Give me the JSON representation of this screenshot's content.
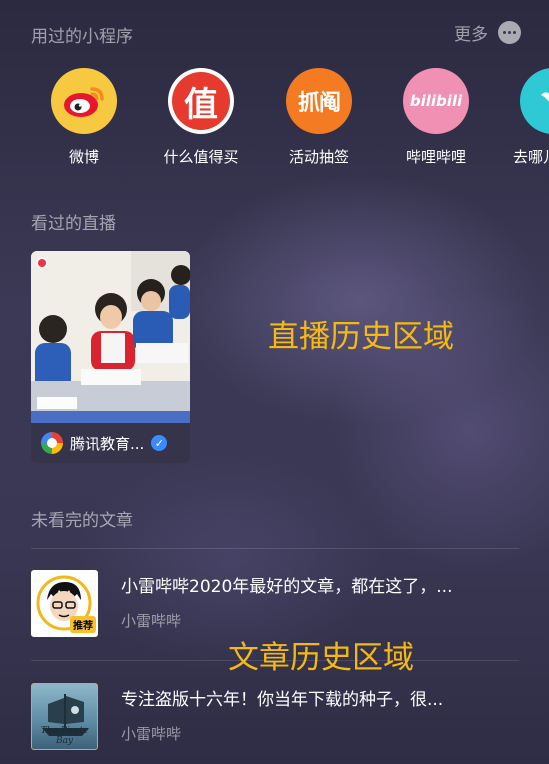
{
  "mini_programs": {
    "title": "用过的小程序",
    "more_label": "更多",
    "apps": [
      {
        "label": "微博",
        "icon": "weibo-icon"
      },
      {
        "label": "什么值得买",
        "icon": "smzdm-icon",
        "glyph": "值"
      },
      {
        "label": "活动抽签",
        "icon": "huodong-icon",
        "glyph": "抓阄"
      },
      {
        "label": "哔哩哔哩",
        "icon": "bilibili-icon",
        "glyph": "bilibili"
      },
      {
        "label": "去哪儿",
        "icon": "qunar-icon"
      }
    ]
  },
  "live": {
    "title": "看过的直播",
    "card": {
      "channel": "腾讯教育...",
      "verified": true
    },
    "overlay": "直播历史区域"
  },
  "articles": {
    "title": "未看完的文章",
    "items": [
      {
        "headline": "小雷哔哔2020年最好的文章，都在这了，...",
        "source": "小雷哔哔",
        "badge": "推荐"
      },
      {
        "headline": "专注盗版十六年！你当年下载的种子，很...",
        "source": "小雷哔哔",
        "thumb_text": "The Pirate Bay"
      }
    ],
    "overlay": "文章历史区域"
  },
  "colors": {
    "accent": "#f5b90f",
    "background": "#3a3754"
  }
}
